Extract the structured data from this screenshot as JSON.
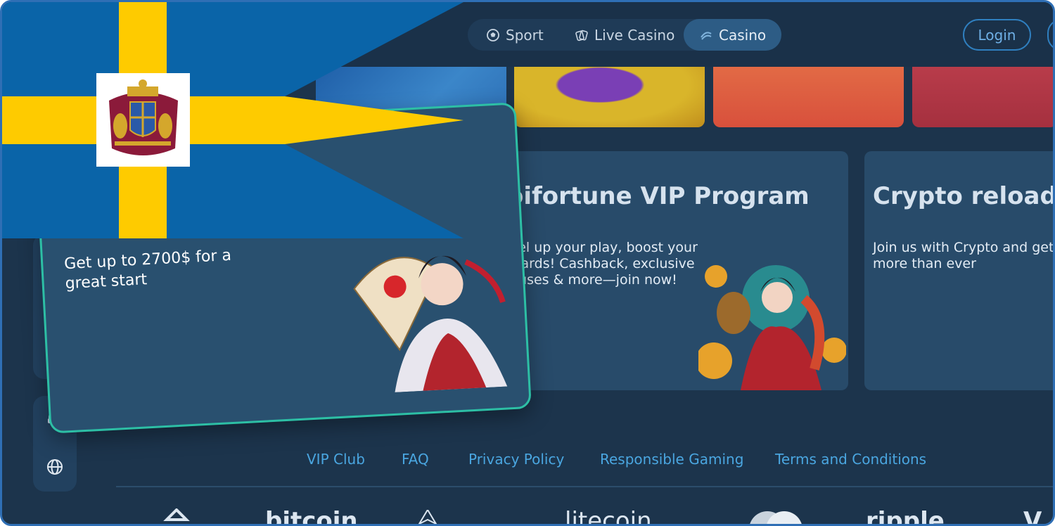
{
  "nav": {
    "items": [
      {
        "label": "Sport",
        "icon": "soccer-ball-icon"
      },
      {
        "label": "Live Casino",
        "icon": "cards-icon"
      },
      {
        "label": "Casino",
        "icon": "slot-icon",
        "active": true
      }
    ],
    "login_label": "Login"
  },
  "bonus_card": {
    "text": "Get up to 2700$ for a great start"
  },
  "promos": [
    {
      "title": "oifortune VIP Program",
      "text": "vel up your play, boost your wards! Cashback, exclusive nuses & more—join now!"
    },
    {
      "title": "Crypto reload b",
      "text": "Join us with Crypto and get more than ever"
    }
  ],
  "footer": {
    "links": [
      "VIP Club",
      "FAQ",
      "Privacy Policy",
      "Responsible Gaming",
      "Terms and Conditions"
    ]
  },
  "payments": [
    {
      "name": "tron-logo"
    },
    {
      "name": "bitcoin-logo",
      "label": "bitcoin"
    },
    {
      "name": "ethereum-logo"
    },
    {
      "name": "litecoin-logo",
      "label": "litecoin"
    },
    {
      "name": "mastercard-logo"
    },
    {
      "name": "ripple-logo",
      "label": "ripple"
    },
    {
      "name": "visa-logo",
      "label": "V"
    }
  ],
  "colors": {
    "background": "#1c344c",
    "accent_teal": "#2dbfa5",
    "link_blue": "#4aa6e0",
    "flag_blue": "#0a64a8",
    "flag_yellow": "#fecb00"
  }
}
